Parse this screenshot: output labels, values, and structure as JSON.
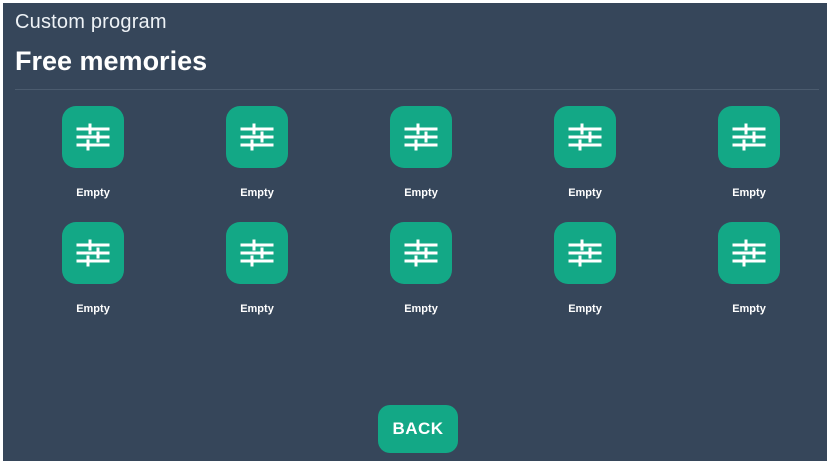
{
  "header": {
    "subtitle": "Custom program",
    "title": "Free memories"
  },
  "memories": [
    {
      "label": "Empty",
      "icon": "sliders-icon"
    },
    {
      "label": "Empty",
      "icon": "sliders-icon"
    },
    {
      "label": "Empty",
      "icon": "sliders-icon"
    },
    {
      "label": "Empty",
      "icon": "sliders-icon"
    },
    {
      "label": "Empty",
      "icon": "sliders-icon"
    },
    {
      "label": "Empty",
      "icon": "sliders-icon"
    },
    {
      "label": "Empty",
      "icon": "sliders-icon"
    },
    {
      "label": "Empty",
      "icon": "sliders-icon"
    },
    {
      "label": "Empty",
      "icon": "sliders-icon"
    },
    {
      "label": "Empty",
      "icon": "sliders-icon"
    }
  ],
  "footer": {
    "back_label": "BACK"
  },
  "colors": {
    "background": "#36465a",
    "accent": "#13a886",
    "text": "#ffffff"
  }
}
